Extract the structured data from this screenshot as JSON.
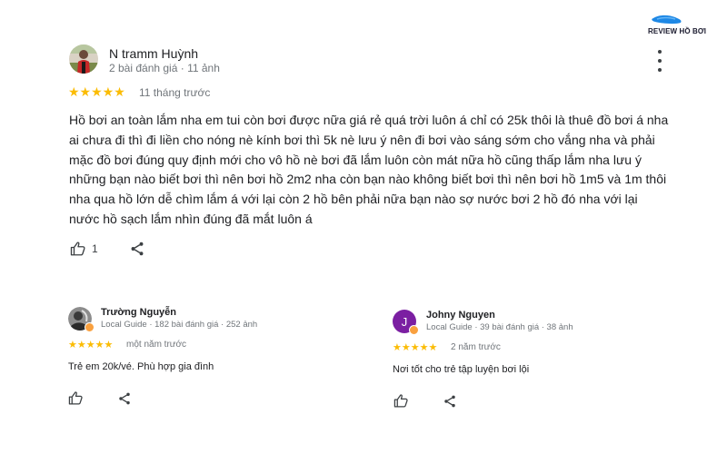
{
  "brand": {
    "logo_text": "REVIEW HỒ BƠI"
  },
  "main_review": {
    "author": "N tramm Huỳnh",
    "meta": "2 bài đánh giá · 11 ảnh",
    "stars": "★★★★★",
    "rating": 5,
    "time": "11 tháng trước",
    "text": "Hồ bơi an toàn lắm nha em tui còn bơi được nữa giá rẻ quá trời luôn á chỉ có 25k thôi là thuê đồ bơi á nha ai chưa đi thì đi liền cho nóng nè kính bơi thì 5k nè lưu ý nên đi bơi vào sáng sớm cho vắng nha và phải mặc đồ bơi đúng quy định mới cho vô hồ nè bơi đã lắm luôn còn mát nữa hồ cũng thấp lắm nha lưu ý những bạn nào biết bơi thì nên bơi hồ 2m2 nha còn bạn nào không biết bơi thì nên bơi hồ 1m5 và 1m thôi nha qua hồ lớn dễ chìm lắm á với lại còn 2 hồ bên phải nữa bạn nào sợ nước bơi 2 hồ đó nha với lại nước hồ sạch lắm nhìn đúng đã mắt luôn á",
    "likes": "1"
  },
  "review_left": {
    "author": "Trường Nguyễn",
    "meta": "Local Guide · 182 bài đánh giá · 252 ảnh",
    "stars": "★★★★★",
    "rating": 5,
    "time": "một năm trước",
    "text": "Trẻ em 20k/vé. Phù hợp gia đình"
  },
  "review_right": {
    "author": "Johny Nguyen",
    "avatar_initial": "J",
    "avatar_color": "#7b1fa2",
    "meta": "Local Guide · 39 bài đánh giá · 38 ảnh",
    "stars": "★★★★★",
    "rating": 5,
    "time": "2 năm trước",
    "text": "Nơi tốt cho trẻ tập luyện bơi lội"
  },
  "colors": {
    "star": "#fbbc04",
    "badge": "#f9a03f",
    "muted": "#70757a"
  }
}
